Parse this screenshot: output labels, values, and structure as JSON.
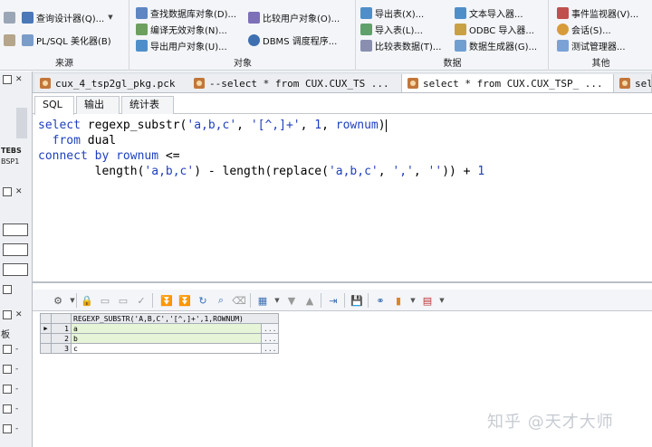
{
  "ribbon": {
    "groups": [
      {
        "label": "来源",
        "items": [
          "查询设计器(Q)...",
          "PL/SQL 美化器(B)"
        ]
      },
      {
        "label": "对象",
        "items": [
          "查找数据库对象(D)...",
          "编译无效对象(N)...",
          "导出用户对象(U)...",
          "比较用户对象(O)...",
          "DBMS 调度程序..."
        ]
      },
      {
        "label": "数据",
        "items": [
          "导出表(X)...",
          "导入表(L)...",
          "比较表数据(T)...",
          "文本导入器...",
          "ODBC 导入器...",
          "数据生成器(G)..."
        ]
      },
      {
        "label": "其他",
        "items": [
          "事件监视器(V)...",
          "会话(S)...",
          "测试管理器..."
        ]
      }
    ]
  },
  "left_panel": {
    "texts": [
      "TEBS",
      "BSP1",
      "板"
    ]
  },
  "doc_tabs": [
    {
      "label": "cux_4_tsp2gl_pkg.pck"
    },
    {
      "label": "--select * from CUX.CUX_TS ..."
    },
    {
      "label": "select * from CUX.CUX_TSP_ ..."
    },
    {
      "label": "sel"
    }
  ],
  "sub_tabs": [
    "SQL",
    "输出",
    "统计表"
  ],
  "editor": {
    "lines": [
      {
        "indent": "",
        "parts": [
          [
            "kw",
            "select "
          ],
          [
            "fn",
            "regexp_substr"
          ],
          [
            "p",
            "("
          ],
          [
            "str",
            "'a,b,c'"
          ],
          [
            "p",
            ", "
          ],
          [
            "str",
            "'[^,]+'"
          ],
          [
            "p",
            ", "
          ],
          [
            "num",
            "1"
          ],
          [
            "p",
            ", "
          ],
          [
            "kw",
            "rownum"
          ],
          [
            "p",
            ")"
          ]
        ]
      },
      {
        "indent": "  ",
        "parts": [
          [
            "kw",
            "from "
          ],
          [
            "p",
            "dual"
          ]
        ]
      },
      {
        "indent": "",
        "parts": [
          [
            "kw",
            "connect by "
          ],
          [
            "kw",
            "rownum"
          ],
          [
            "p",
            " <="
          ]
        ]
      },
      {
        "indent": "        ",
        "parts": [
          [
            "fn",
            "length"
          ],
          [
            "p",
            "("
          ],
          [
            "str",
            "'a,b,c'"
          ],
          [
            "p",
            ") - "
          ],
          [
            "fn",
            "length"
          ],
          [
            "p",
            "("
          ],
          [
            "fn",
            "replace"
          ],
          [
            "p",
            "("
          ],
          [
            "str",
            "'a,b,c'"
          ],
          [
            "p",
            ", "
          ],
          [
            "str",
            "','"
          ],
          [
            "p",
            ", "
          ],
          [
            "str",
            "''"
          ],
          [
            "p",
            ")) + "
          ],
          [
            "num",
            "1"
          ]
        ]
      }
    ]
  },
  "results": {
    "column": "REGEXP_SUBSTR('A,B,C','[^,]+',1,ROWNUM)",
    "rows": [
      {
        "n": "1",
        "value": "a"
      },
      {
        "n": "2",
        "value": "b"
      },
      {
        "n": "3",
        "value": "c"
      }
    ],
    "cell_button": "..."
  },
  "watermark": "知乎 @天才大师",
  "colors": {
    "keyword": "#1f3fbf",
    "selected_row": "#e6f4d8",
    "ribbon_bg": "#f3f5f8"
  }
}
